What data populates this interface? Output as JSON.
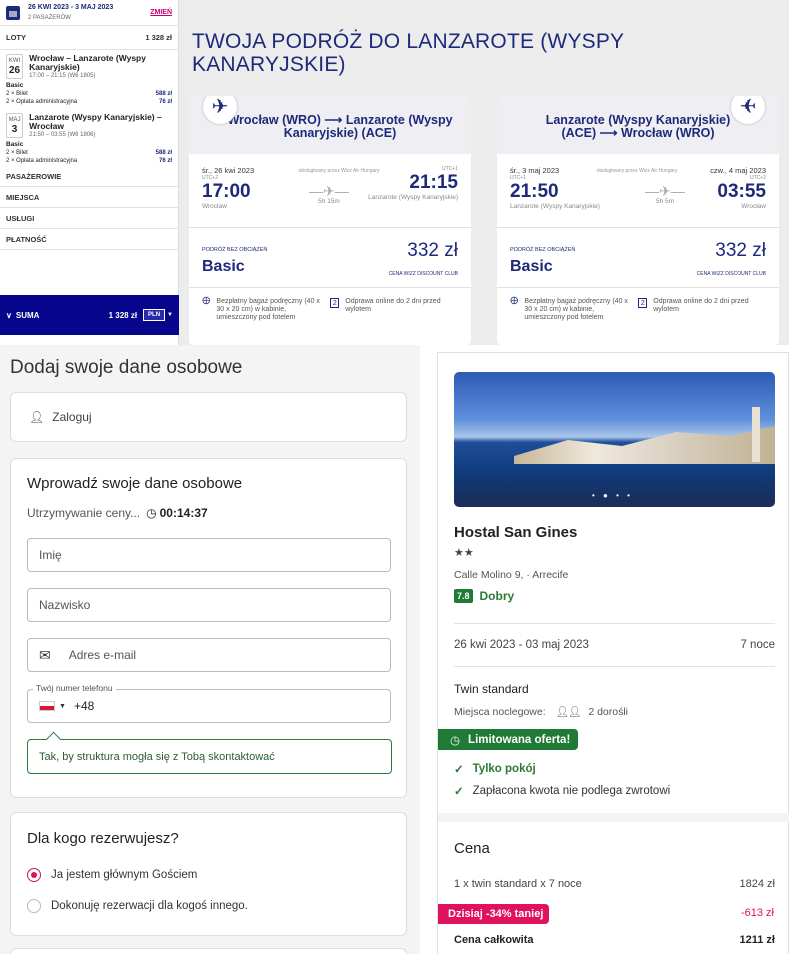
{
  "wizz": {
    "summary": {
      "dates": "26 KWI 2023 - 3 MAJ 2023",
      "passengers": "2 PASAŻERÓW",
      "change": "ZMIEŃ"
    },
    "flights_label": "LOTY",
    "flights_total": "1 328 zł",
    "flights": [
      {
        "month": "KWI",
        "day": "26",
        "title": "Wrocław – Lanzarote (Wyspy Kanaryjskie)",
        "time": "17:00 – 21:15 (W6 1805)",
        "fare": "Basic",
        "line1": "2 × Bilet",
        "line1_price": "588 zł",
        "line2": "2 × Opłata administracyjna",
        "line2_price": "76 zł"
      },
      {
        "month": "MAJ",
        "day": "3",
        "title": "Lanzarote (Wyspy Kanaryjskie) – Wrocław",
        "time": "21:50 – 03:55 (W6 1806)",
        "fare": "Basic",
        "line1": "2 × Bilet",
        "line1_price": "588 zł",
        "line2": "2 × Opłata administracyjna",
        "line2_price": "76 zł"
      }
    ],
    "sections": [
      "PASAŻEROWIE",
      "MIEJSCA",
      "USŁUGI",
      "PŁATNOŚĆ"
    ],
    "total_label": "SUMA",
    "total": "1 328 zł",
    "currency": "PLN",
    "title": "TWOJA PODRÓŻ DO LANZAROTE (WYSPY KANARYJSKIE)",
    "cards": [
      {
        "route": "Wrocław (WRO) ⟶ Lanzarote (Wyspy Kanaryjskie) (ACE)",
        "dep_date": "śr., 26 kwi 2023",
        "operator": "obsługiwany przez Wizz Air Hungary",
        "dep_utc": "UTC+2",
        "arr_utc": "UTC+1",
        "dep_time": "17:00",
        "arr_time": "21:15",
        "duration": "5h 15m",
        "dep_city": "Wrocław",
        "arr_city": "Lanzarote (Wyspy Kanaryjskie)",
        "arr_date": "",
        "fare_small": "PODRÓŻ BEZ OBCIĄŻEŃ",
        "fare": "Basic",
        "price": "332 zł",
        "club": "CENA WIZZ DISCOUNT CLUB",
        "feat1": "Bezpłatny bagaż podręczny (40 x 30 x 20 cm) w kabinie, umieszczony pod fotelem",
        "feat2": "Odprawa online do 2 dni przed wylotem"
      },
      {
        "route": "Lanzarote (Wyspy Kanaryjskie) (ACE) ⟶ Wrocław (WRO)",
        "dep_date": "śr., 3 maj 2023",
        "operator": "obsługiwany przez Wizz Air Hungary",
        "dep_utc": "UTC+1",
        "arr_utc": "UTC+2",
        "dep_time": "21:50",
        "arr_time": "03:55",
        "duration": "5h 5m",
        "dep_city": "Lanzarote (Wyspy Kanaryjskie)",
        "arr_city": "Wrocław",
        "arr_date": "czw., 4 maj 2023",
        "fare_small": "PODRÓŻ BEZ OBCIĄŻEŃ",
        "fare": "Basic",
        "price": "332 zł",
        "club": "CENA WIZZ DISCOUNT CLUB",
        "feat1": "Bezpłatny bagaż podręczny (40 x 30 x 20 cm) w kabinie, umieszczony pod fotelem",
        "feat2": "Odprawa online do 2 dni przed wylotem"
      }
    ]
  },
  "form": {
    "title": "Dodaj swoje dane osobowe",
    "login": "Zaloguj",
    "section_title": "Wprowadź swoje dane osobowe",
    "hold_label": "Utrzymywanie ceny...",
    "hold_timer": "00:14:37",
    "first_name_placeholder": "Imię",
    "last_name_placeholder": "Nazwisko",
    "email_placeholder": "Adres e-mail",
    "phone_label": "Twój numer telefonu",
    "phone_prefix": "+48",
    "hint": "Tak, by struktura mogła się z Tobą skontaktować",
    "whom_title": "Dla kogo rezerwujesz?",
    "option1": "Ja jestem głównym Gościem",
    "option2": "Dokonuję rezerwacji dla kogoś innego."
  },
  "hotel": {
    "name": "Hostal San Gines",
    "stars": "★★",
    "address": "Calle Molino 9, · Arrecife",
    "score": "7.8",
    "score_label": "Dobry",
    "dates": "26 kwi 2023 - 03 maj 2023",
    "nights": "7 noce",
    "room": "Twin standard",
    "beds_label": "Miejsca noclegowe:",
    "beds_value": "2 dorośli",
    "limited": "Limitowana oferta!",
    "check1": "Tylko pokój",
    "check2": "Zapłacona kwota nie podlega zwrotowi",
    "price_title": "Cena",
    "line1_label": "1 x twin standard x 7 noce",
    "line1_value": "1824 zł",
    "discount_label": "Dzisiaj -34% taniej",
    "discount_value": "-613 zł",
    "total_label": "Cena całkowita",
    "total_value": "1211 zł"
  },
  "colors": {
    "wizz_navy": "#1d2a7a",
    "wizz_magenta": "#c6006e",
    "green": "#1f7a36",
    "discount": "#e0115f"
  }
}
